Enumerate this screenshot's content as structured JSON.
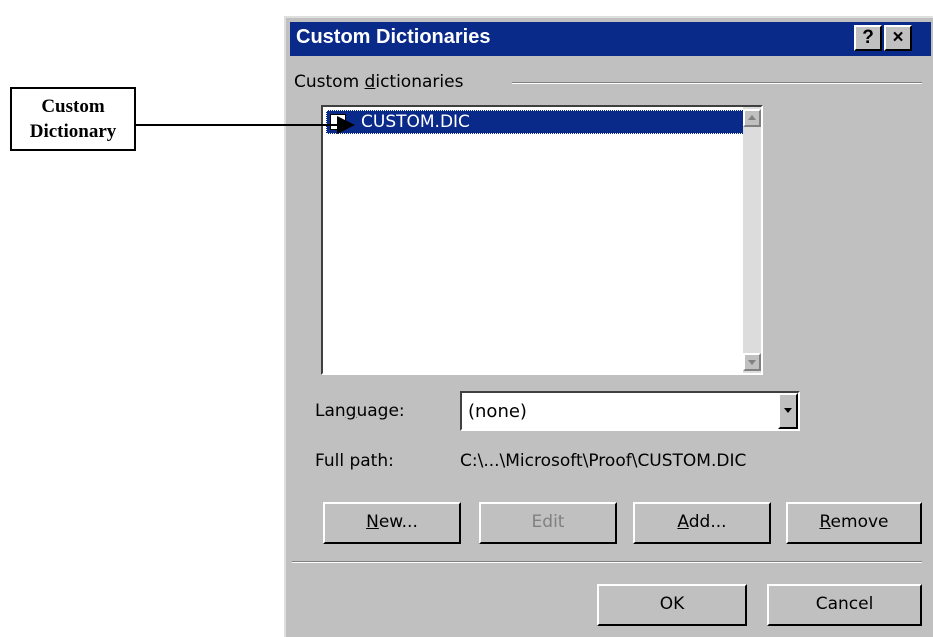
{
  "callout": {
    "line1": "Custom",
    "line2": "Dictionary"
  },
  "dialog": {
    "title": "Custom Dictionaries",
    "help_button": "?",
    "close_button": "×",
    "group_label_prefix": "Custom ",
    "group_label_accel": "d",
    "group_label_suffix": "ictionaries",
    "list": {
      "items": [
        {
          "label": "CUSTOM.DIC",
          "checked": false,
          "selected": true
        }
      ]
    },
    "language": {
      "label_prefix": "Lan",
      "label_accel": "g",
      "label_suffix": "uage:",
      "value": "(none)"
    },
    "full_path": {
      "label": "Full path:",
      "value": "C:\\...\\Microsoft\\Proof\\CUSTOM.DIC"
    },
    "buttons": {
      "new_accel": "N",
      "new_rest": "ew...",
      "edit": "Edit",
      "add_accel": "A",
      "add_rest": "dd...",
      "remove_accel": "R",
      "remove_rest": "emove",
      "ok": "OK",
      "cancel": "Cancel"
    }
  },
  "colors": {
    "title_bar": "#0a2a8a",
    "dialog_face": "#c0c0c0",
    "selection": "#0a2a8a"
  }
}
